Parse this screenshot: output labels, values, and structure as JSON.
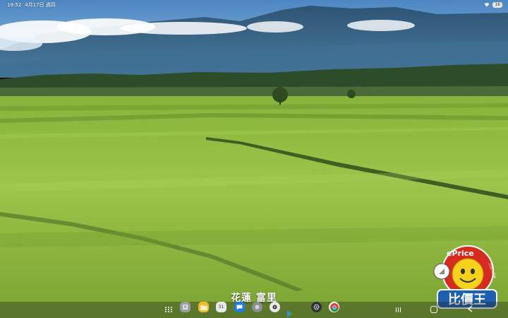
{
  "status_bar": {
    "time": "19:52",
    "date": "4月17日 週四",
    "battery": "16"
  },
  "caption": "花蓮 富里",
  "taskbar": {
    "calendar_day": "31"
  },
  "watermark": {
    "brand": "ePrice",
    "domain": ".com.tw",
    "chinese": "比價王"
  },
  "colors": {
    "sky": "#5f9bd2",
    "mountain": "#3f6d8f",
    "field": "#8fbd3a",
    "watermark_red": "#d62b20"
  }
}
